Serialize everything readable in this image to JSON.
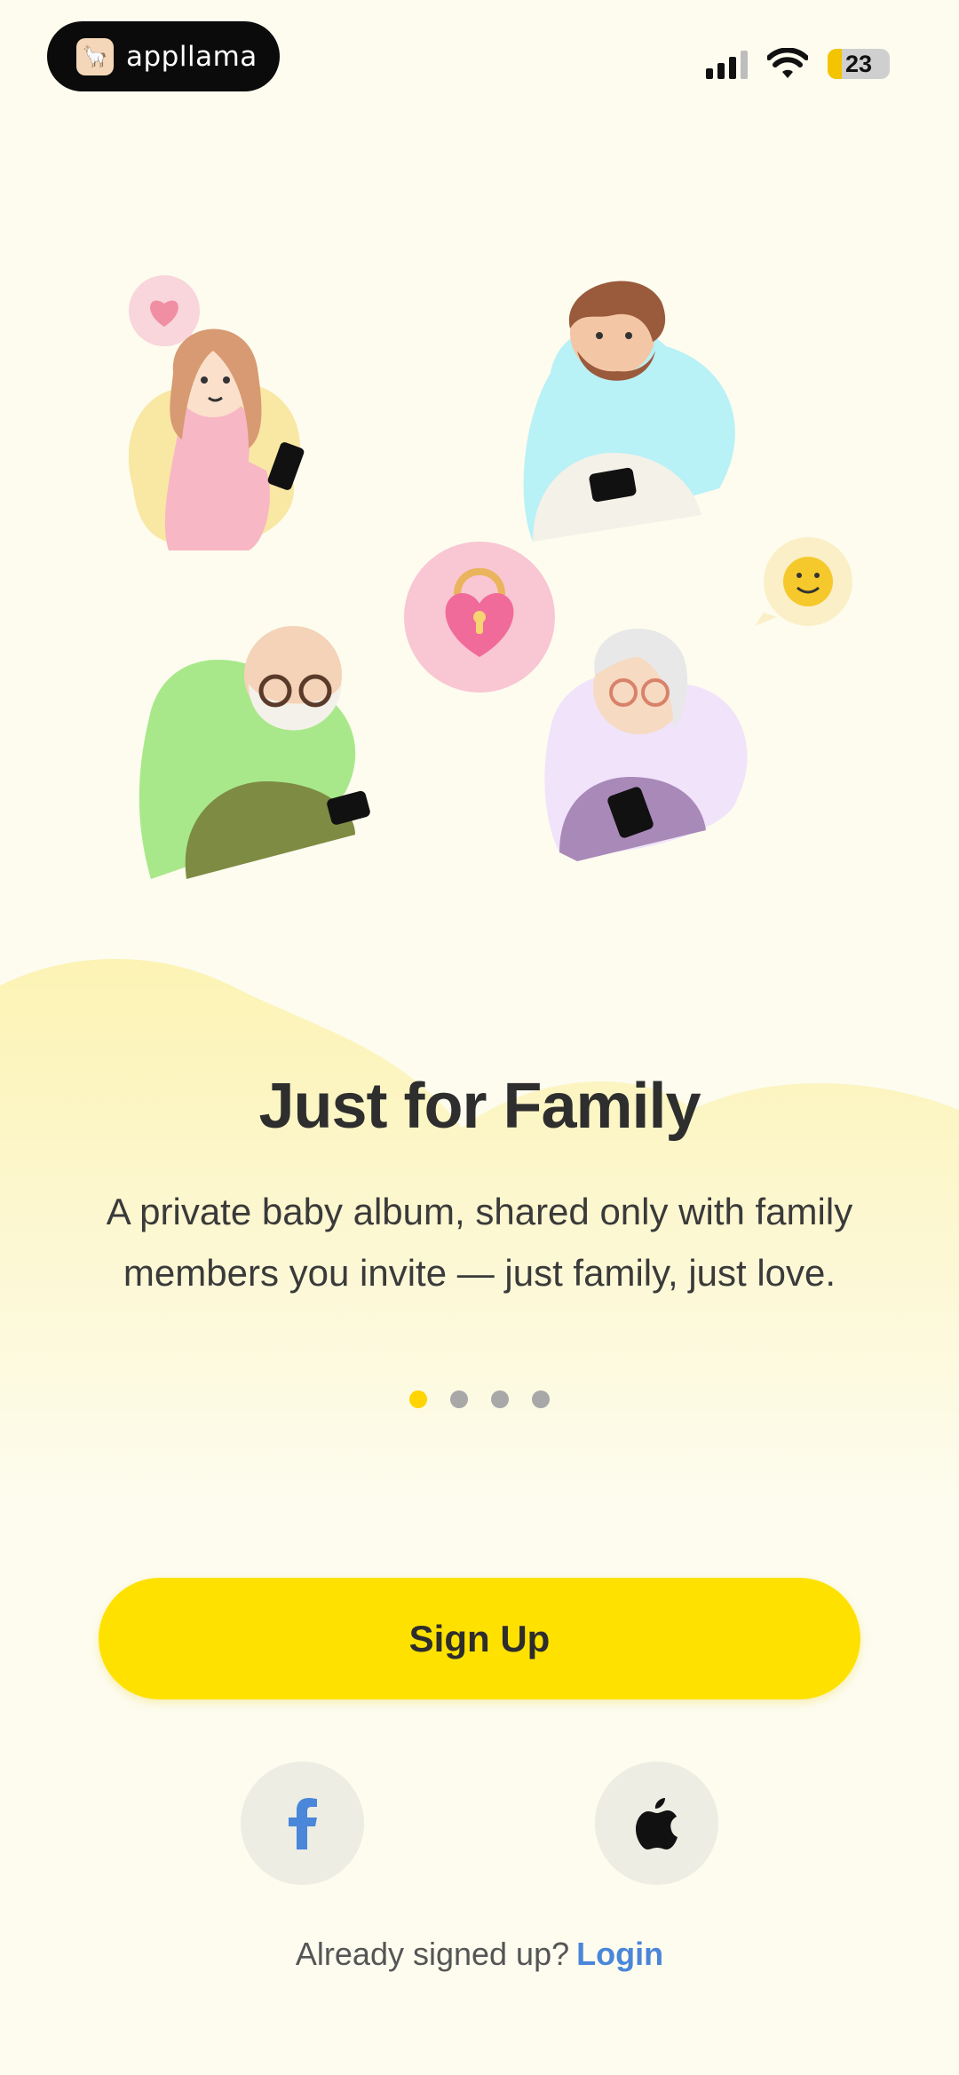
{
  "status_bar": {
    "app_pill_label": "appllama",
    "battery_level": "23"
  },
  "onboarding": {
    "title": "Just for Family",
    "description": "A private baby album, shared only with family members you invite — just family, just love.",
    "pager": {
      "total": 4,
      "active_index": 0
    }
  },
  "actions": {
    "signup_label": "Sign Up",
    "facebook_icon": "facebook-icon",
    "apple_icon": "apple-icon",
    "already_text": "Already signed up?",
    "login_label": "Login"
  },
  "colors": {
    "background": "#FDFCEF",
    "accent": "#FFE100",
    "link": "#4A86D9"
  }
}
